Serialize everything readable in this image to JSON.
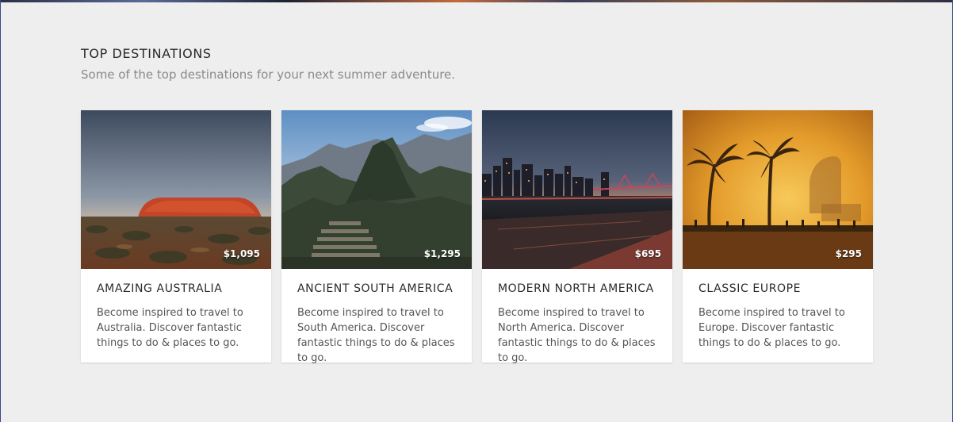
{
  "section": {
    "title": "TOP DESTINATIONS",
    "subtitle": "Some of the top destinations for your next summer adventure."
  },
  "cards": [
    {
      "title": "AMAZING AUSTRALIA",
      "price": "$1,095",
      "description": "Become inspired to travel to Australia. Discover fantastic things to do & places to go.",
      "image": "uluru-sunset-photo"
    },
    {
      "title": "ANCIENT SOUTH AMERICA",
      "price": "$1,295",
      "description": "Become inspired to travel to South America. Discover fantastic things to do & places to go.",
      "image": "machu-picchu-photo"
    },
    {
      "title": "MODERN NORTH AMERICA",
      "price": "$695",
      "description": "Become inspired to travel to North America. Discover fantastic things to do & places to go.",
      "image": "city-skyline-night-photo"
    },
    {
      "title": "CLASSIC EUROPE",
      "price": "$295",
      "description": "Become inspired to travel to Europe. Discover fantastic things to do & places to go.",
      "image": "palm-beach-sunset-photo"
    }
  ],
  "colors": {
    "background": "#eeeeee",
    "card": "#ffffff",
    "heading": "#2b2b2b",
    "muted": "#8a8a8a"
  }
}
